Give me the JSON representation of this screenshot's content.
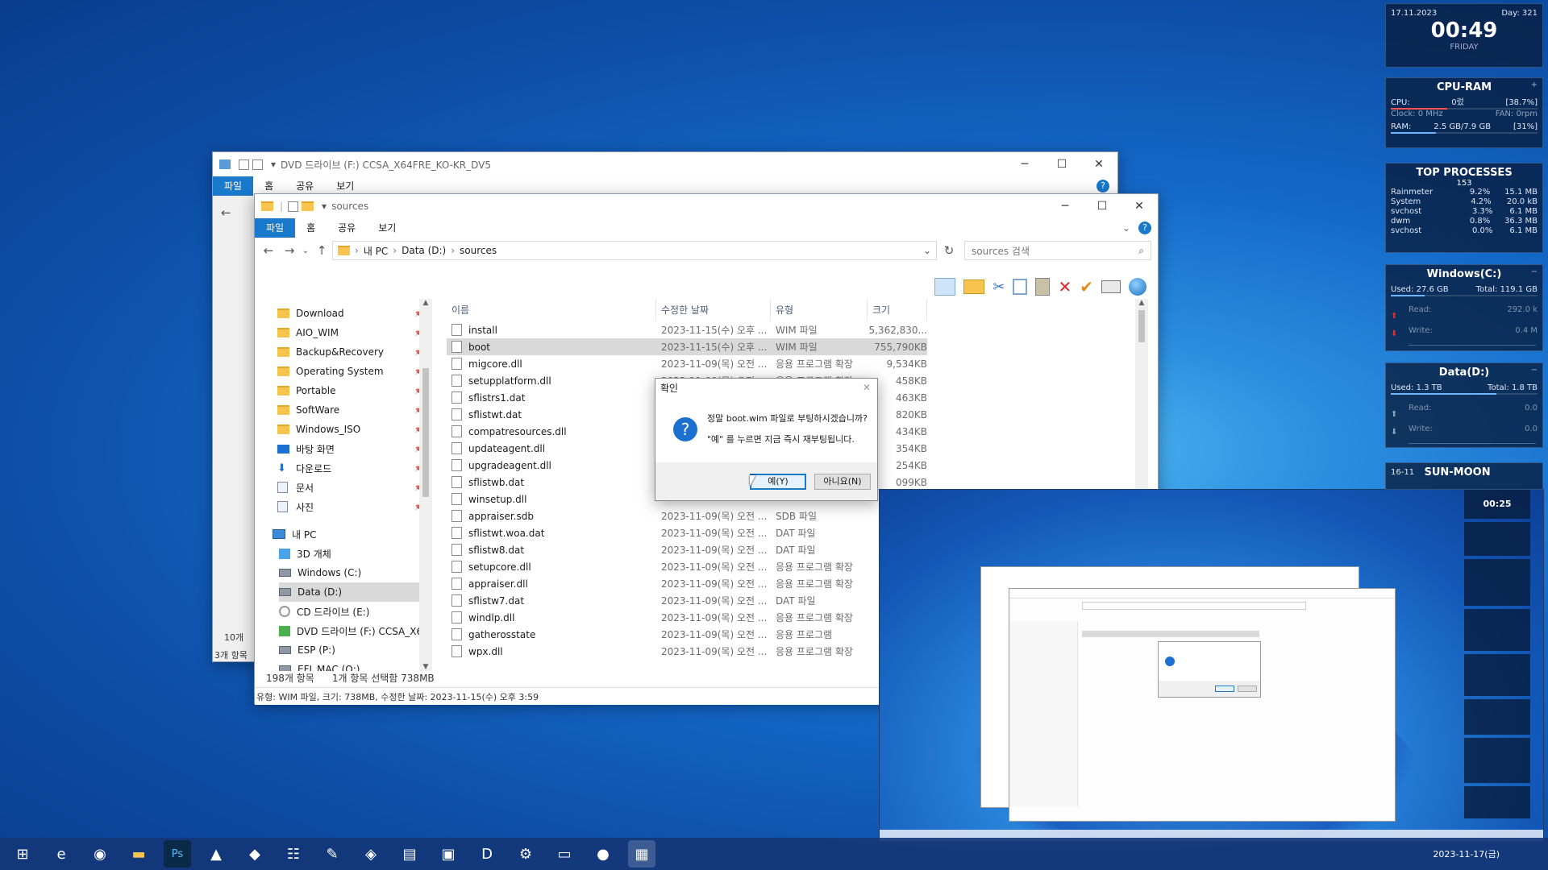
{
  "back_window": {
    "title": "DVD 드라이브 (F:) CCSA_X64FRE_KO-KR_DV5",
    "tabs": [
      "파일",
      "홈",
      "공유",
      "보기"
    ],
    "status_items": "10개",
    "status_selected": "3개 항목"
  },
  "front_window": {
    "title": "sources",
    "tabs": [
      "파일",
      "홈",
      "공유",
      "보기"
    ],
    "breadcrumb": [
      "내 PC",
      "Data (D:)",
      "sources"
    ],
    "search_placeholder": "sources 검색",
    "quick_access": [
      {
        "label": "Download",
        "icon": "folder"
      },
      {
        "label": "AIO_WIM",
        "icon": "folder"
      },
      {
        "label": "Backup&Recovery",
        "icon": "folder"
      },
      {
        "label": "Operating System",
        "icon": "folder"
      },
      {
        "label": "Portable",
        "icon": "folder"
      },
      {
        "label": "SoftWare",
        "icon": "folder"
      },
      {
        "label": "Windows_ISO",
        "icon": "folder"
      },
      {
        "label": "바탕 화면",
        "icon": "desktop"
      },
      {
        "label": "다운로드",
        "icon": "download"
      },
      {
        "label": "문서",
        "icon": "document"
      },
      {
        "label": "사진",
        "icon": "picture"
      }
    ],
    "this_pc_label": "내 PC",
    "this_pc": [
      {
        "label": "3D 개체",
        "icon": "3d"
      },
      {
        "label": "Windows (C:)",
        "icon": "drive"
      },
      {
        "label": "Data (D:)",
        "icon": "drive"
      },
      {
        "label": "CD 드라이브 (E:)",
        "icon": "cd"
      },
      {
        "label": "DVD 드라이브 (F:) CCSA_X6",
        "icon": "dvd"
      },
      {
        "label": "ESP (P:)",
        "icon": "drive"
      },
      {
        "label": "EFI_MAC (Q:)",
        "icon": "drive"
      }
    ],
    "columns": {
      "name": "이름",
      "date": "수정한 날짜",
      "type": "유형",
      "size": "크기"
    },
    "files": [
      {
        "name": "install",
        "date": "2023-11-15(수) 오후 ...",
        "type": "WIM 파일",
        "size": "5,362,830..."
      },
      {
        "name": "boot",
        "date": "2023-11-15(수) 오후 ...",
        "type": "WIM 파일",
        "size": "755,790KB"
      },
      {
        "name": "migcore.dll",
        "date": "2023-11-09(목) 오전 ...",
        "type": "응용 프로그램 확장",
        "size": "9,534KB"
      },
      {
        "name": "setupplatform.dll",
        "date": "2023-11-09(목) 오전 ...",
        "type": "응용 프로그램 확장",
        "size": "458KB"
      },
      {
        "name": "sflistrs1.dat",
        "date": "",
        "type": "",
        "size": "463KB"
      },
      {
        "name": "sflistwt.dat",
        "date": "",
        "type": "",
        "size": "820KB"
      },
      {
        "name": "compatresources.dll",
        "date": "",
        "type": "",
        "size": "434KB"
      },
      {
        "name": "updateagent.dll",
        "date": "",
        "type": "",
        "size": "354KB"
      },
      {
        "name": "upgradeagent.dll",
        "date": "",
        "type": "",
        "size": "254KB"
      },
      {
        "name": "sflistwb.dat",
        "date": "",
        "type": "",
        "size": "099KB"
      },
      {
        "name": "winsetup.dll",
        "date": "",
        "type": "",
        "size": ""
      },
      {
        "name": "appraiser.sdb",
        "date": "2023-11-09(목) 오전 ...",
        "type": "SDB 파일",
        "size": ""
      },
      {
        "name": "sflistwt.woa.dat",
        "date": "2023-11-09(목) 오전 ...",
        "type": "DAT 파일",
        "size": ""
      },
      {
        "name": "sflistw8.dat",
        "date": "2023-11-09(목) 오전 ...",
        "type": "DAT 파일",
        "size": ""
      },
      {
        "name": "setupcore.dll",
        "date": "2023-11-09(목) 오전 ...",
        "type": "응용 프로그램 확장",
        "size": ""
      },
      {
        "name": "appraiser.dll",
        "date": "2023-11-09(목) 오전 ...",
        "type": "응용 프로그램 확장",
        "size": ""
      },
      {
        "name": "sflistw7.dat",
        "date": "2023-11-09(목) 오전 ...",
        "type": "DAT 파일",
        "size": ""
      },
      {
        "name": "windlp.dll",
        "date": "2023-11-09(목) 오전 ...",
        "type": "응용 프로그램 확장",
        "size": ""
      },
      {
        "name": "gatherosstate",
        "date": "2023-11-09(목) 오전 ...",
        "type": "응용 프로그램",
        "size": ""
      },
      {
        "name": "wpx.dll",
        "date": "2023-11-09(목) 오전 ...",
        "type": "응용 프로그램 확장",
        "size": ""
      }
    ],
    "status_count": "198개 항목",
    "status_selected": "1개 항목 선택함 738MB",
    "details_bar": "유형: WIM 파일, 크기: 738MB, 수정한 날짜: 2023-11-15(수) 오후 3:59"
  },
  "dialog": {
    "title": "확인",
    "line1": "정말 boot.wim 파일로 부팅하시겠습니까?",
    "line2": "\"예\" 를 누르면 지금 즉시 재부팅됩니다.",
    "yes": "예(Y)",
    "no": "아니요(N)"
  },
  "widgets": {
    "date": "17.11.2023",
    "day": "Day: 321",
    "time": "00:49",
    "weekday": "FRIDAY",
    "cpu_title": "CPU-RAM",
    "cpu_label": "CPU:",
    "cpu_name": "0렀",
    "cpu_pct": "[38.7%]",
    "clock": "Clock: 0 MHz",
    "fan": "FAN: 0rpm",
    "ram_label": "RAM:",
    "ram_val": "2.5 GB/7.9 GB",
    "ram_pct": "[31%]",
    "top_title": "TOP PROCESSES",
    "top_count": "153",
    "processes": [
      {
        "n": "Rainmeter",
        "c": "9.2%",
        "m": "15.1 MB"
      },
      {
        "n": "System",
        "c": "4.2%",
        "m": "20.0 kB"
      },
      {
        "n": "svchost",
        "c": "3.3%",
        "m": "6.1 MB"
      },
      {
        "n": "dwm",
        "c": "0.8%",
        "m": "36.3 MB"
      },
      {
        "n": "svchost",
        "c": "0.0%",
        "m": "6.1 MB"
      }
    ],
    "c_title": "Windows(C:)",
    "c_used": "Used: 27.6 GB",
    "c_total": "Total: 119.1 GB",
    "c_read": "Read:",
    "c_read_v": "292.0 k",
    "c_write": "Write:",
    "c_write_v": "0.4 M",
    "d_title": "Data(D:)",
    "d_used": "Used: 1.3 TB",
    "d_total": "Total: 1.8 TB",
    "d_read": "Read:",
    "d_read_v": "0.0",
    "d_write": "Write:",
    "d_write_v": "0.0",
    "sun_title": "SUN-MOON",
    "sun_date": "16-11"
  },
  "preview": {
    "clock": "00:25"
  },
  "taskbar": {
    "icons": [
      "windows-start-icon",
      "ie-icon",
      "edge-icon",
      "file-explorer-icon",
      "photoshop-icon",
      "app-triangle-icon",
      "app-red-icon",
      "app-network-icon",
      "app-paint-icon",
      "app-disk-icon",
      "app-usb-icon",
      "app-pink-icon",
      "app-d-icon",
      "app-tool-icon",
      "app-notepad-icon",
      "app-media-icon",
      "app-explorer-active-icon"
    ],
    "clock": "2023-11-17(금)"
  },
  "colors": {
    "accent": "#1979ca",
    "selection": "#cce8ff",
    "selected_gray": "#d9d9d9"
  }
}
